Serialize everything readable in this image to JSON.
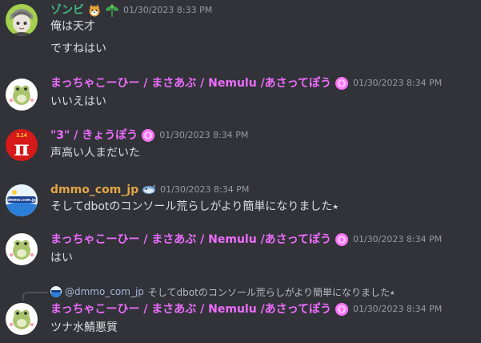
{
  "colors": {
    "background": "#313338",
    "zombie_name": "#43b581",
    "pink_name": "#ee6cff",
    "orange_name": "#e5a645",
    "timestamp": "#949ba4",
    "text": "#dbdee1"
  },
  "messages": [
    {
      "author": "ゾンビ",
      "timestamp": "01/30/2023 8:33 PM",
      "lines": [
        "俺は天才",
        "ですねはい"
      ],
      "badges": [
        "shiba-dog-icon",
        "seedling-icon"
      ]
    },
    {
      "author": "まっちゃこーひー / まさあぶ / Nemulu /あさってぽう",
      "timestamp": "01/30/2023 8:34 PM",
      "lines": [
        "いいえはい"
      ],
      "badges": [
        "booster-gem-icon"
      ]
    },
    {
      "author": "\"3\" / きょうぽう",
      "timestamp": "01/30/2023 8:34 PM",
      "lines": [
        "声高い人まだいた"
      ],
      "badges": [
        "booster-gem-icon"
      ],
      "avatar_text": "π",
      "avatar_small_text": "3.14"
    },
    {
      "author": "dmmo_com_jp",
      "timestamp": "01/30/2023 8:34 PM",
      "lines": [
        "そしてdbotのコンソール荒らしがより簡単になりました⭑"
      ],
      "badges": [
        "dolphin-icon"
      ],
      "avatar_text": "dmmo.com.jp"
    },
    {
      "author": "まっちゃこーひー / まさあぶ / Nemulu /あさってぽう",
      "timestamp": "01/30/2023 8:34 PM",
      "lines": [
        "はい"
      ],
      "badges": [
        "booster-gem-icon"
      ]
    },
    {
      "author": "まっちゃこーひー / まさあぶ / Nemulu /あさってぽう",
      "timestamp": "01/30/2023 8:34 PM",
      "lines": [
        "ツナ水鯖悪質"
      ],
      "badges": [
        "booster-gem-icon"
      ]
    }
  ],
  "reply": {
    "name": "@dmmo_com_jp",
    "text": "そしてdbotのコンソール荒らしがより簡単になりました⭑"
  }
}
